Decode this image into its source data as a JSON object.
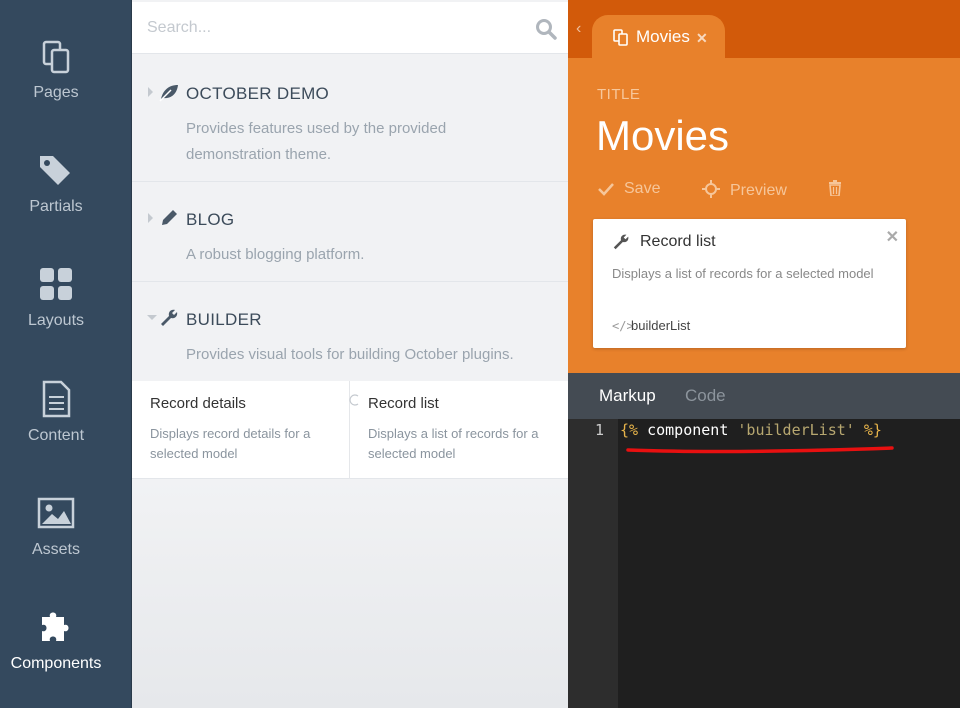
{
  "sidebar": {
    "items": [
      {
        "label": "Pages",
        "icon": "pages-icon"
      },
      {
        "label": "Partials",
        "icon": "tag-icon"
      },
      {
        "label": "Layouts",
        "icon": "grid-icon"
      },
      {
        "label": "Content",
        "icon": "document-icon"
      },
      {
        "label": "Assets",
        "icon": "image-icon"
      },
      {
        "label": "Components",
        "icon": "puzzle-icon"
      }
    ]
  },
  "search": {
    "placeholder": "Search..."
  },
  "plugins": [
    {
      "title": "OCTOBER DEMO",
      "description": "Provides features used by the provided demonstration theme.",
      "icon": "leaf-icon"
    },
    {
      "title": "BLOG",
      "description": "A robust blogging platform.",
      "icon": "pencil-icon"
    },
    {
      "title": "BUILDER",
      "description": "Provides visual tools for building October plugins.",
      "icon": "wrench-icon"
    }
  ],
  "components": [
    {
      "title": "Record details",
      "description": "Displays record details for a selected model"
    },
    {
      "title": "Record list",
      "description": "Displays a list of records for a selected model"
    }
  ],
  "editor": {
    "tab_label": "Movies",
    "field_label": "TITLE",
    "title_value": "Movies",
    "toolbar": {
      "save": "Save",
      "preview": "Preview"
    },
    "card": {
      "title": "Record list",
      "description": "Displays a list of records for a selected model",
      "alias": "builderList"
    },
    "tabs": {
      "markup": "Markup",
      "code": "Code"
    },
    "code": {
      "line_number": "1",
      "open_tag": "{%",
      "keyword": "component",
      "string": "'builderList'",
      "close_tag": "%}"
    }
  },
  "colors": {
    "sidebar": "#34495e",
    "accent": "#e8812b",
    "tab_strip": "#d25a0a",
    "annotation": "#e81010"
  }
}
